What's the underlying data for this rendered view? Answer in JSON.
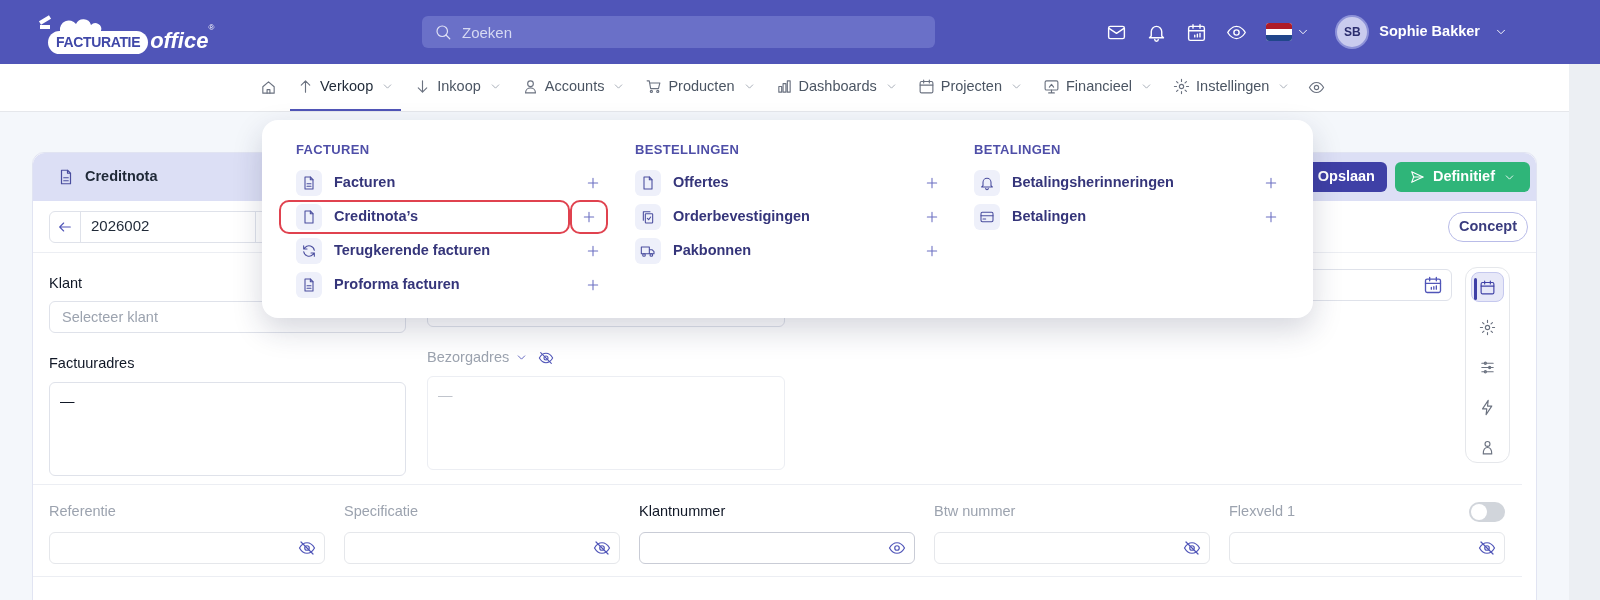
{
  "logo": {
    "word": "FACTURATIE",
    "script": "office",
    "mark": "®"
  },
  "search": {
    "placeholder": "Zoeken"
  },
  "user": {
    "initials": "SB",
    "name": "Sophie Bakker"
  },
  "nav": [
    {
      "label": "Verkoop",
      "selected": true
    },
    {
      "label": "Inkoop",
      "selected": false
    },
    {
      "label": "Accounts",
      "selected": false
    },
    {
      "label": "Producten",
      "selected": false
    },
    {
      "label": "Dashboards",
      "selected": false
    },
    {
      "label": "Projecten",
      "selected": false
    },
    {
      "label": "Financieel",
      "selected": false
    },
    {
      "label": "Instellingen",
      "selected": false
    }
  ],
  "menu": [
    {
      "heading": "FACTUREN",
      "items": [
        {
          "label": "Facturen",
          "highlighted": false
        },
        {
          "label": "Creditnota’s",
          "highlighted": true
        },
        {
          "label": "Terugkerende facturen",
          "highlighted": false
        },
        {
          "label": "Proforma facturen",
          "highlighted": false
        }
      ]
    },
    {
      "heading": "BESTELLINGEN",
      "items": [
        {
          "label": "Offertes",
          "highlighted": false
        },
        {
          "label": "Orderbevestigingen",
          "highlighted": false
        },
        {
          "label": "Pakbonnen",
          "highlighted": false
        }
      ]
    },
    {
      "heading": "BETALINGEN",
      "items": [
        {
          "label": "Betalingsherinneringen",
          "highlighted": false
        },
        {
          "label": "Betalingen",
          "highlighted": false
        }
      ]
    }
  ],
  "card": {
    "title": "Creditnota",
    "save": "Opslaan",
    "final": "Definitief",
    "number": "2026002",
    "status": "Concept"
  },
  "client": {
    "label": "Klant",
    "placeholder": "Selecteer klant"
  },
  "billing": {
    "label": "Factuuradres",
    "value": "—"
  },
  "delivery": {
    "label": "Bezorgadres",
    "value": "—"
  },
  "fields": [
    {
      "label": "Referentie",
      "visible": false
    },
    {
      "label": "Specificatie",
      "visible": false
    },
    {
      "label": "Klantnummer",
      "visible": true
    },
    {
      "label": "Btw nummer",
      "visible": false
    },
    {
      "label": "Flexveld 1",
      "visible": false,
      "toggle": false
    }
  ],
  "side_panel": [
    {
      "selected": true
    },
    {
      "selected": false
    },
    {
      "selected": false
    },
    {
      "selected": false
    },
    {
      "selected": false
    }
  ]
}
